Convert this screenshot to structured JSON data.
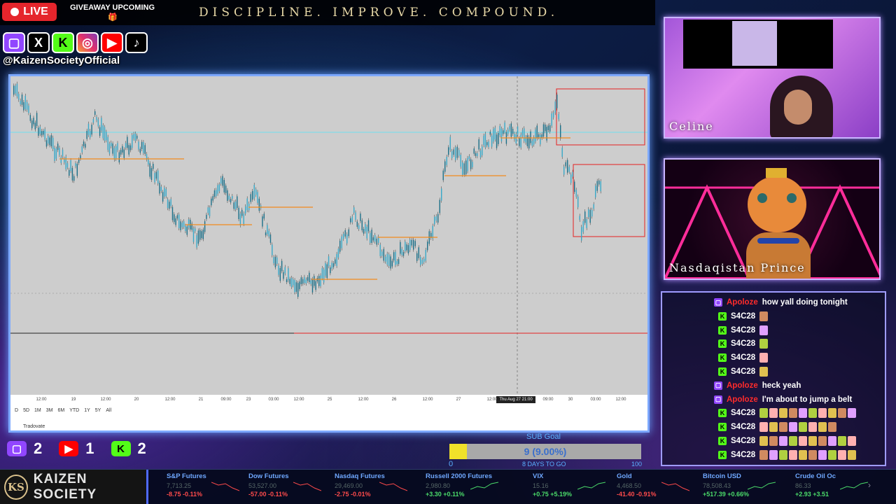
{
  "header": {
    "live_label": "LIVE",
    "giveaway": "GIVEAWAY UPCOMING",
    "motto": "DISCIPLINE. IMPROVE. COMPOUND."
  },
  "socials": {
    "icons": [
      "twitch-icon",
      "x-icon",
      "kick-icon",
      "instagram-icon",
      "youtube-icon",
      "tiktok-icon"
    ],
    "handle": "@KaizenSocietyOfficial"
  },
  "chart": {
    "x_ticks": [
      "12:00",
      "19",
      "12:00",
      "20",
      "12:00",
      "21",
      "09:00",
      "23",
      "03:00",
      "12:00",
      "25",
      "12:00",
      "26",
      "12:00",
      "27",
      "12:00",
      "09:00",
      "30",
      "03:00",
      "12:00"
    ],
    "crosshair_label": "Thu Aug 27  21:00",
    "toolbar": [
      "D",
      "5D",
      "1M",
      "3M",
      "6M",
      "YTD",
      "1Y",
      "5Y",
      "All"
    ],
    "brand": "Tradovate"
  },
  "cams": {
    "cam1_name": "Celine",
    "cam2_name": "Nasdaqistan Prince"
  },
  "chat": [
    {
      "platform": "twitch",
      "user": "Apoloze",
      "msg": "how yall doing tonight"
    },
    {
      "platform": "kick",
      "user": "S4C28",
      "msg": ""
    },
    {
      "platform": "kick",
      "user": "S4C28",
      "msg": ""
    },
    {
      "platform": "kick",
      "user": "S4C28",
      "msg": ""
    },
    {
      "platform": "kick",
      "user": "S4C28",
      "msg": ""
    },
    {
      "platform": "kick",
      "user": "S4C28",
      "msg": ""
    },
    {
      "platform": "twitch",
      "user": "Apoloze",
      "msg": "heck yeah"
    },
    {
      "platform": "twitch",
      "user": "Apoloze",
      "msg": "I'm about to jump a belt"
    },
    {
      "platform": "kick",
      "user": "S4C28",
      "msg": ""
    },
    {
      "platform": "kick",
      "user": "S4C28",
      "msg": ""
    },
    {
      "platform": "kick",
      "user": "S4C28",
      "msg": ""
    },
    {
      "platform": "kick",
      "user": "S4C28",
      "msg": ""
    }
  ],
  "counters": {
    "twitch": "2",
    "youtube": "1",
    "kick": "2"
  },
  "sub_goal": {
    "label": "SUB Goal",
    "value_text": "9 (9.00%)",
    "fraction": 0.09,
    "min": "0",
    "days": "8 DAYS TO GO",
    "max": "100"
  },
  "brand": {
    "logo_text": "KS",
    "name": "KAIZEN SOCIETY"
  },
  "ticker": [
    {
      "name": "S&P Futures",
      "price": "7,713.25",
      "change": "-8.75 -0.11%",
      "dir": "neg"
    },
    {
      "name": "Dow Futures",
      "price": "53,527.00",
      "change": "-57.00 -0.11%",
      "dir": "neg"
    },
    {
      "name": "Nasdaq Futures",
      "price": "29,469.00",
      "change": "-2.75 -0.01%",
      "dir": "neg"
    },
    {
      "name": "Russell 2000 Futures",
      "price": "2,980.80",
      "change": "+3.30 +0.11%",
      "dir": "pos"
    },
    {
      "name": "VIX",
      "price": "15.16",
      "change": "+0.75 +5.19%",
      "dir": "pos"
    },
    {
      "name": "Gold",
      "price": "4,468.50",
      "change": "-41.40 -0.91%",
      "dir": "neg"
    },
    {
      "name": "Bitcoin USD",
      "price": "78,508.43",
      "change": "+517.39 +0.66%",
      "dir": "pos"
    },
    {
      "name": "Crude Oil Oc",
      "price": "86.33",
      "change": "+2.93 +3.51",
      "dir": "pos"
    }
  ],
  "colors": {
    "live_red": "#e5252c",
    "twitch_purple": "#9146ff",
    "kick_green": "#53fc18",
    "youtube_red": "#ff0000",
    "chart_candle": "#38a8c8",
    "level_orange": "#f28a1e",
    "level_red": "#e52121",
    "level_cyan": "#6fe0f0"
  }
}
